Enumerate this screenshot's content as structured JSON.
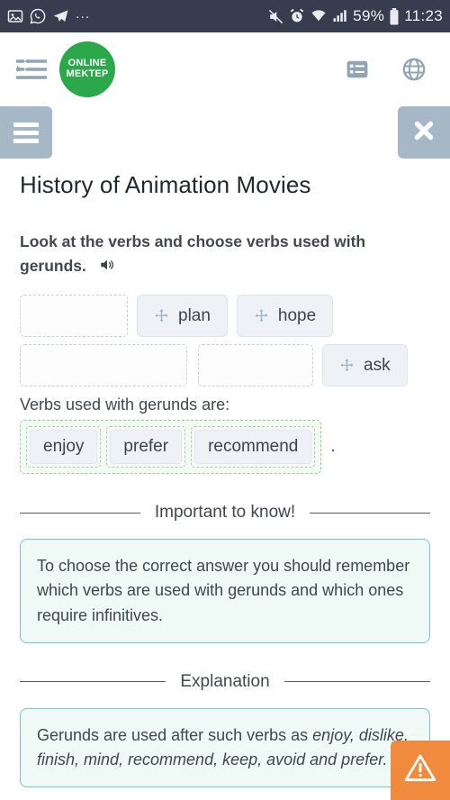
{
  "statusbar": {
    "left_icons": [
      "gallery-icon",
      "whatsapp-icon",
      "telegram-icon"
    ],
    "overflow": "...",
    "right_icons": [
      "mute-icon",
      "alarm-icon",
      "wifi-icon",
      "signal-icon",
      "battery-icon"
    ],
    "battery_percent": "59%",
    "clock": "11:23"
  },
  "header": {
    "indent_icon": "indent-icon",
    "logo_line1": "ONLINE",
    "logo_line2": "MEKTEP",
    "list_icon": "list-icon",
    "globe_icon": "globe-icon"
  },
  "toolbar": {
    "menu_icon": "hamburger-icon",
    "close_icon": "close-icon"
  },
  "main": {
    "title": "History of Animation Movies",
    "prompt": "Look at the verbs and choose verbs used with gerunds.",
    "audio_icon": "speaker-icon",
    "pool": {
      "row1": [
        {
          "kind": "slot",
          "label": ""
        },
        {
          "kind": "chip",
          "label": "plan"
        },
        {
          "kind": "chip",
          "label": "hope"
        }
      ],
      "row2": [
        {
          "kind": "slot",
          "label": ""
        },
        {
          "kind": "slot",
          "label": ""
        },
        {
          "kind": "chip",
          "label": "ask"
        }
      ]
    },
    "answer_label": "Verbs used with gerunds are:",
    "answer_chips": [
      "enjoy",
      "prefer",
      "recommend"
    ],
    "answer_period": ".",
    "divider_important": "Important to know!",
    "important_text": "To choose the correct answer you should remember which verbs are used with gerunds and which ones require infinitives.",
    "divider_explanation": "Explanation",
    "explanation_prefix": "Gerunds are used after such verbs as ",
    "explanation_italic": "enjoy, dislike, finish, mind, recommend, keep, avoid and prefer."
  },
  "floating": {
    "warning_icon": "warning-triangle-icon"
  },
  "colors": {
    "statusbar_bg": "#373d4e",
    "brand_green": "#2ba84a",
    "tool_gray": "#a6b8c6",
    "card_border": "#7fc4bd",
    "card_bg": "#effaf6",
    "answer_green": "#8fd18f",
    "warning_orange": "#f08a3c"
  }
}
